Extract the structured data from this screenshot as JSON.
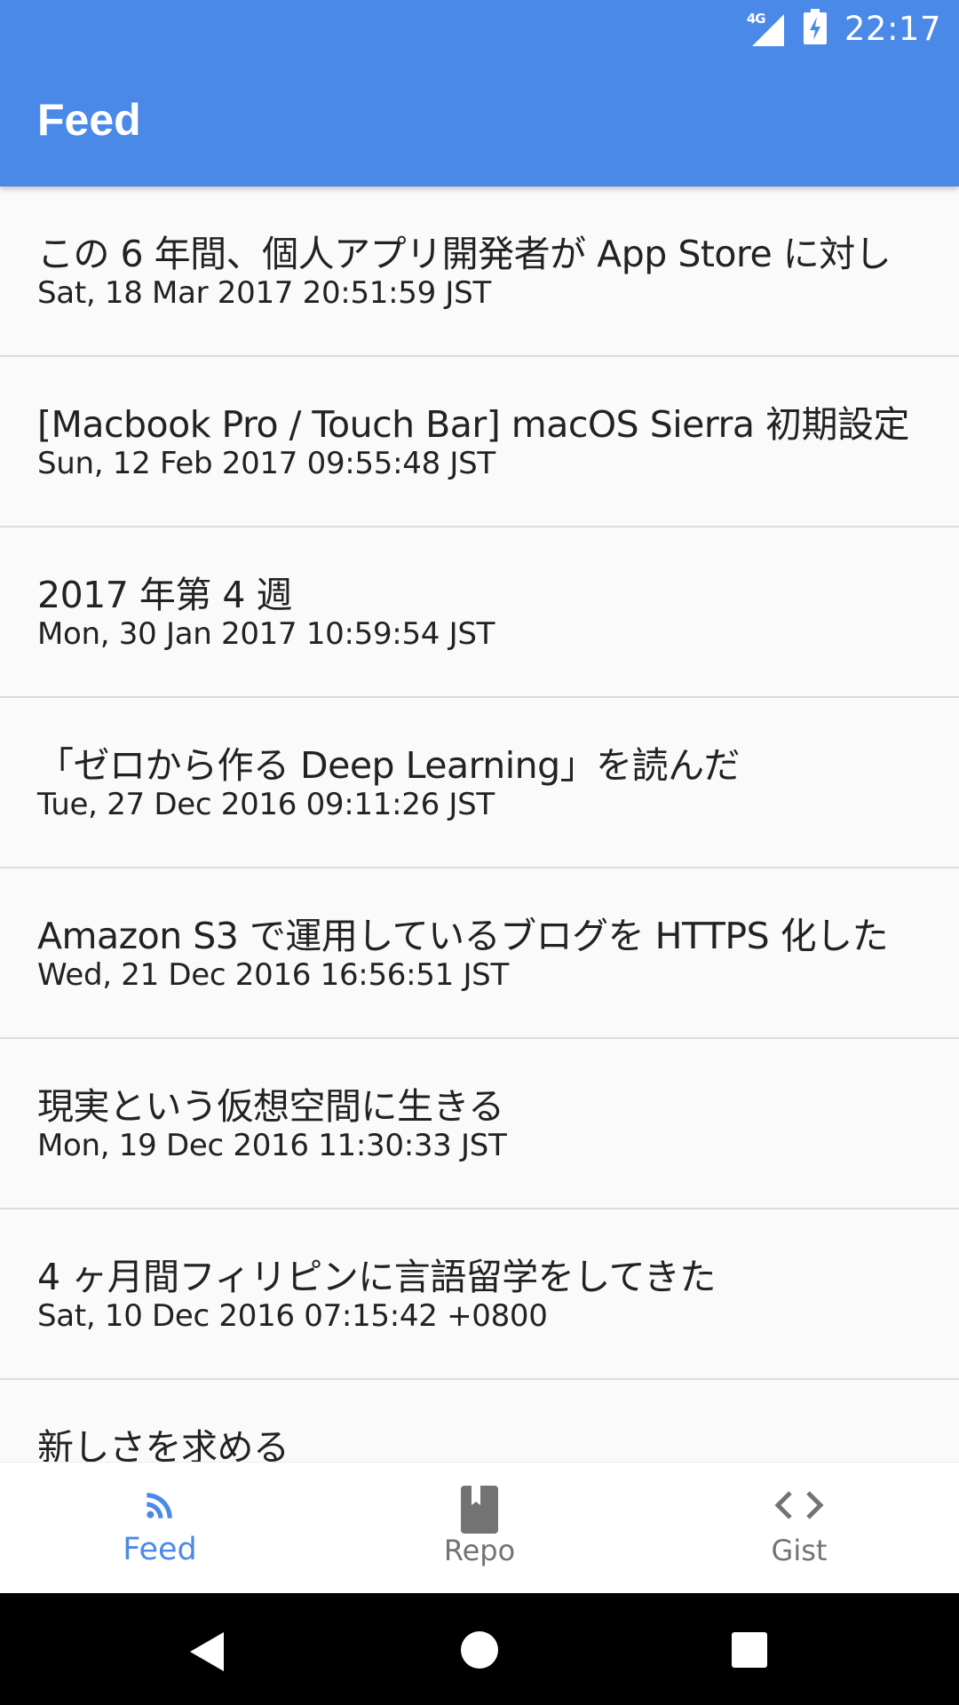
{
  "status_bar": {
    "network": "4G",
    "time": "22:17"
  },
  "app_bar": {
    "title": "Feed"
  },
  "feed": [
    {
      "title": "この 6 年間、個人アプリ開発者が App Store に対し",
      "date": "Sat, 18 Mar 2017 20:51:59 JST"
    },
    {
      "title": "[Macbook Pro / Touch Bar] macOS Sierra 初期設定",
      "date": "Sun, 12 Feb 2017 09:55:48 JST"
    },
    {
      "title": "2017 年第 4 週",
      "date": "Mon, 30 Jan 2017 10:59:54 JST"
    },
    {
      "title": "「ゼロから作る Deep Learning」を読んだ",
      "date": "Tue, 27 Dec 2016 09:11:26 JST"
    },
    {
      "title": "Amazon S3 で運用しているブログを HTTPS 化した",
      "date": "Wed, 21 Dec 2016 16:56:51 JST"
    },
    {
      "title": "現実という仮想空間に生きる",
      "date": "Mon, 19 Dec 2016 11:30:33 JST"
    },
    {
      "title": "4 ヶ月間フィリピンに言語留学をしてきた",
      "date": "Sat, 10 Dec 2016 07:15:42 +0800"
    },
    {
      "title": "新しさを求める",
      "date": ""
    }
  ],
  "bottom_nav": [
    {
      "label": "Feed",
      "icon": "rss-feed-icon",
      "active": true
    },
    {
      "label": "Repo",
      "icon": "book-icon",
      "active": false
    },
    {
      "label": "Gist",
      "icon": "code-icon",
      "active": false
    }
  ],
  "colors": {
    "accent": "#4a89e8",
    "inactive": "#737373",
    "background": "#fafafa"
  }
}
